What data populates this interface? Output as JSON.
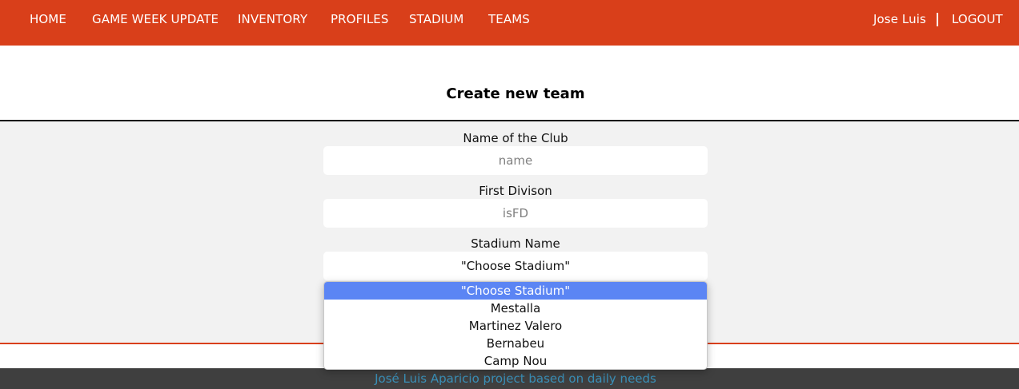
{
  "nav": {
    "items": [
      {
        "label": "HOME"
      },
      {
        "label": "GAME WEEK UPDATE"
      },
      {
        "label": "INVENTORY"
      },
      {
        "label": "PROFILES"
      },
      {
        "label": "STADIUM"
      },
      {
        "label": "TEAMS"
      }
    ],
    "user_name": "Jose Luis",
    "separator": "|",
    "logout_label": "LOGOUT"
  },
  "form": {
    "title": "Create new team",
    "club_name": {
      "label": "Name of the Club",
      "placeholder": "name",
      "value": ""
    },
    "first_division": {
      "label": "First Divison",
      "placeholder": "isFD",
      "value": ""
    },
    "stadium": {
      "label": "Stadium Name",
      "selected": "\"Choose Stadium\"",
      "options": [
        "\"Choose Stadium\"",
        "Mestalla",
        "Martinez Valero",
        "Bernabeu",
        "Camp Nou"
      ]
    }
  },
  "footer": {
    "text": "José Luis Aparicio project based on daily needs"
  },
  "colors": {
    "nav_bg": "#d93f1a",
    "form_bg": "#f2f2f2",
    "footer_bg": "#3f3f3f",
    "footer_text": "#3a8fb7",
    "option_highlight": "#5b85f4"
  }
}
